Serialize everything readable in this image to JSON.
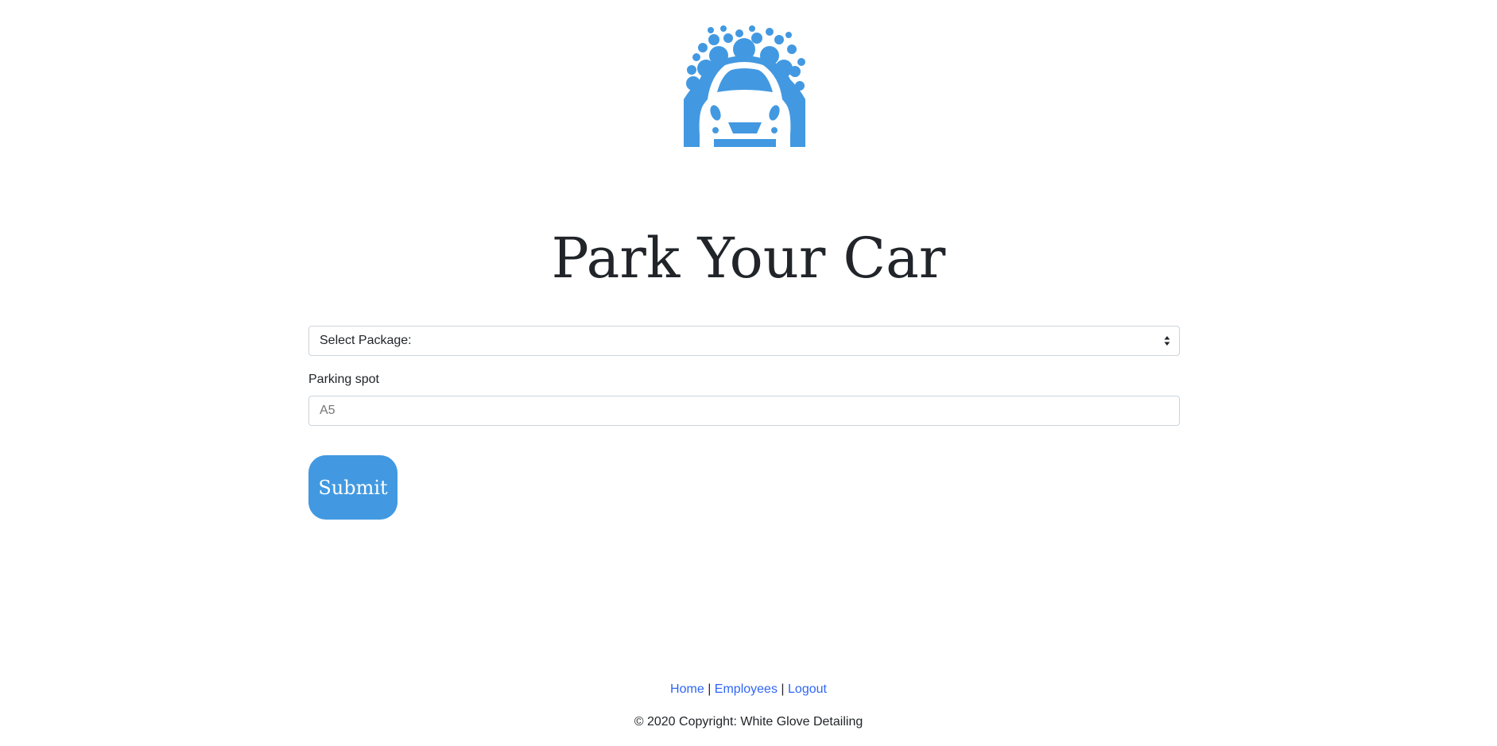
{
  "logo": {
    "icon": "car-wash-icon",
    "color": "#4299e1"
  },
  "page_title": "Park Your Car",
  "form": {
    "package_select": {
      "selected": "Select Package:"
    },
    "parking_spot": {
      "label": "Parking spot",
      "placeholder": "A5"
    },
    "submit_label": "Submit"
  },
  "footer": {
    "links": {
      "home": "Home",
      "employees": "Employees",
      "logout": "Logout"
    },
    "separator": "|",
    "copyright": "© 2020 Copyright: White Glove Detailing"
  },
  "colors": {
    "accent": "#4299e1",
    "link": "#2f66f6",
    "text": "#212529",
    "border": "#ced4da"
  }
}
